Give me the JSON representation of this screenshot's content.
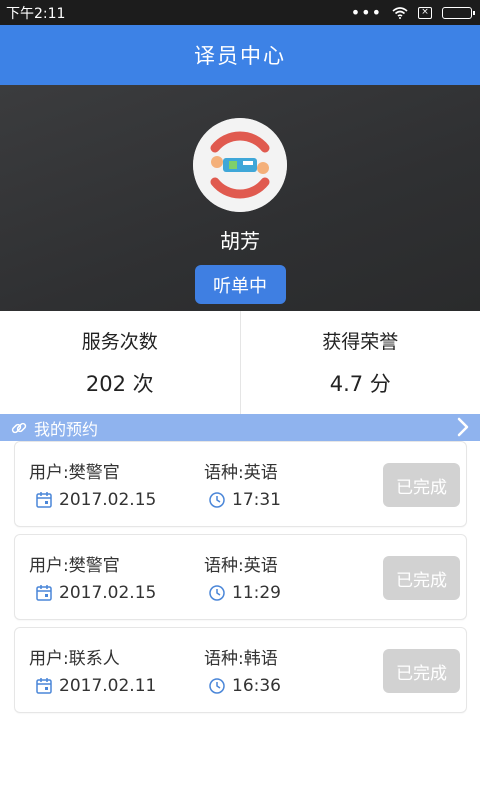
{
  "status_bar": {
    "time": "下午2:11",
    "dots": "•••"
  },
  "header": {
    "title": "译员中心"
  },
  "profile": {
    "name": "胡芳",
    "status_button": "听单中"
  },
  "stats": [
    {
      "label": "服务次数",
      "value": "202 次"
    },
    {
      "label": "获得荣誉",
      "value": "4.7 分"
    }
  ],
  "section": {
    "title": "我的预约"
  },
  "appointments": [
    {
      "user": "用户:樊警官",
      "language": "语种:英语",
      "date": "2017.02.15",
      "time": "17:31",
      "status": "已完成"
    },
    {
      "user": "用户:樊警官",
      "language": "语种:英语",
      "date": "2017.02.15",
      "time": "11:29",
      "status": "已完成"
    },
    {
      "user": "用户:联系人",
      "language": "语种:韩语",
      "date": "2017.02.11",
      "time": "16:36",
      "status": "已完成"
    }
  ],
  "colors": {
    "primary": "#3d82e6",
    "section_bar": "#8fb3ee",
    "done_button": "#d2d2d2",
    "icon_blue": "#4a86d8"
  }
}
